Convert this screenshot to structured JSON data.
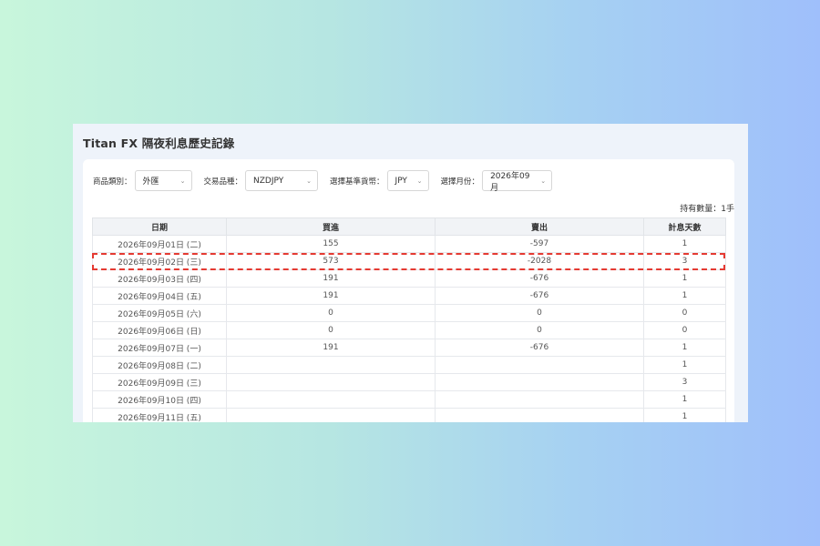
{
  "panel": {
    "title": "Titan FX 隔夜利息歷史記錄"
  },
  "filters": [
    {
      "label": "商品類別：",
      "value": "外匯"
    },
    {
      "label": "交易品種：",
      "value": "NZDJPY"
    },
    {
      "label": "選擇基準貨幣：",
      "value": "JPY"
    },
    {
      "label": "選擇月份：",
      "value": "2026年09月"
    }
  ],
  "quantity_label": "持有數量：1手",
  "table": {
    "headers": [
      "日期",
      "買進",
      "賣出",
      "計息天數"
    ],
    "rows": [
      [
        "2026年09月01日 (二)",
        "155",
        "-597",
        "1"
      ],
      [
        "2026年09月02日 (三)",
        "573",
        "-2028",
        "3"
      ],
      [
        "2026年09月03日 (四)",
        "191",
        "-676",
        "1"
      ],
      [
        "2026年09月04日 (五)",
        "191",
        "-676",
        "1"
      ],
      [
        "2026年09月05日 (六)",
        "0",
        "0",
        "0"
      ],
      [
        "2026年09月06日 (日)",
        "0",
        "0",
        "0"
      ],
      [
        "2026年09月07日 (一)",
        "191",
        "-676",
        "1"
      ],
      [
        "2026年09月08日 (二)",
        "",
        "",
        "1"
      ],
      [
        "2026年09月09日 (三)",
        "",
        "",
        "3"
      ],
      [
        "2026年09月10日 (四)",
        "",
        "",
        "1"
      ],
      [
        "2026年09月11日 (五)",
        "",
        "",
        "1"
      ]
    ]
  },
  "colors": {
    "highlight": "#e53a32",
    "header_bg": "#f1f3f6"
  }
}
